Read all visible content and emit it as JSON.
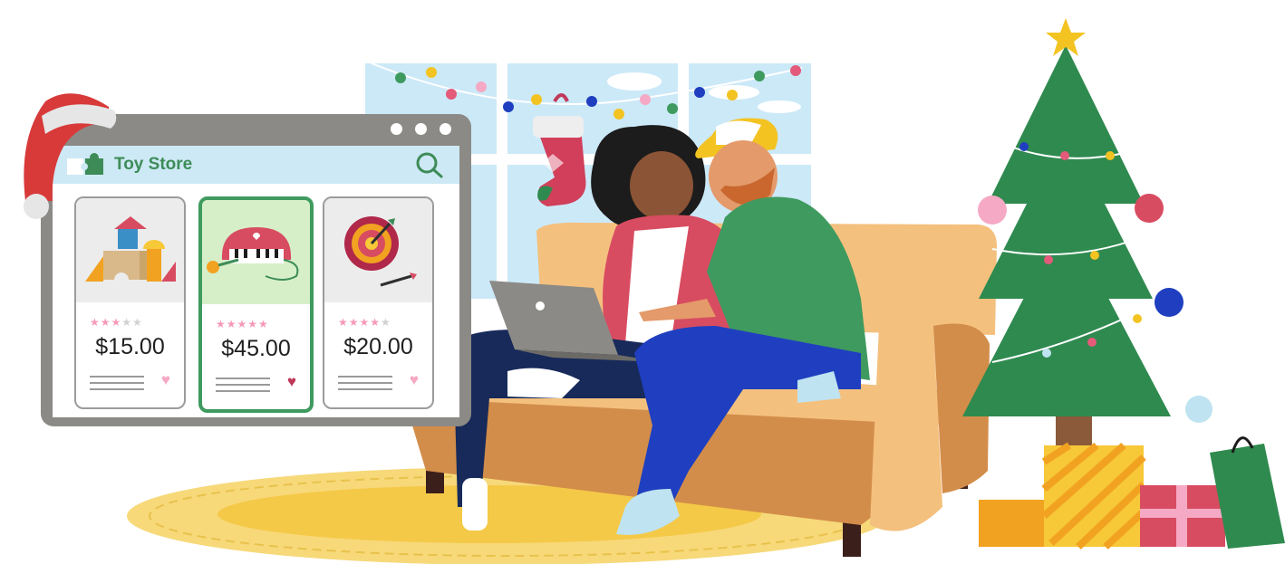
{
  "store": {
    "title": "Toy Store",
    "logo_icon": "puzzle-icon",
    "search_icon": "search-icon"
  },
  "products": [
    {
      "name_icon": "toy-blocks-icon",
      "price": "$15.00",
      "rating": 3,
      "rating_max": 5,
      "favorited": false,
      "selected": false
    },
    {
      "name_icon": "toy-keyboard-icon",
      "price": "$45.00",
      "rating": 5,
      "rating_max": 5,
      "favorited": true,
      "selected": true
    },
    {
      "name_icon": "dartboard-icon",
      "price": "$20.00",
      "rating": 4,
      "rating_max": 5,
      "favorited": false,
      "selected": false
    }
  ],
  "colors": {
    "brand_green": "#3d8c58",
    "topbar": "#cde9f5",
    "star": "#f59ab7",
    "heart_active": "#c0395a"
  }
}
